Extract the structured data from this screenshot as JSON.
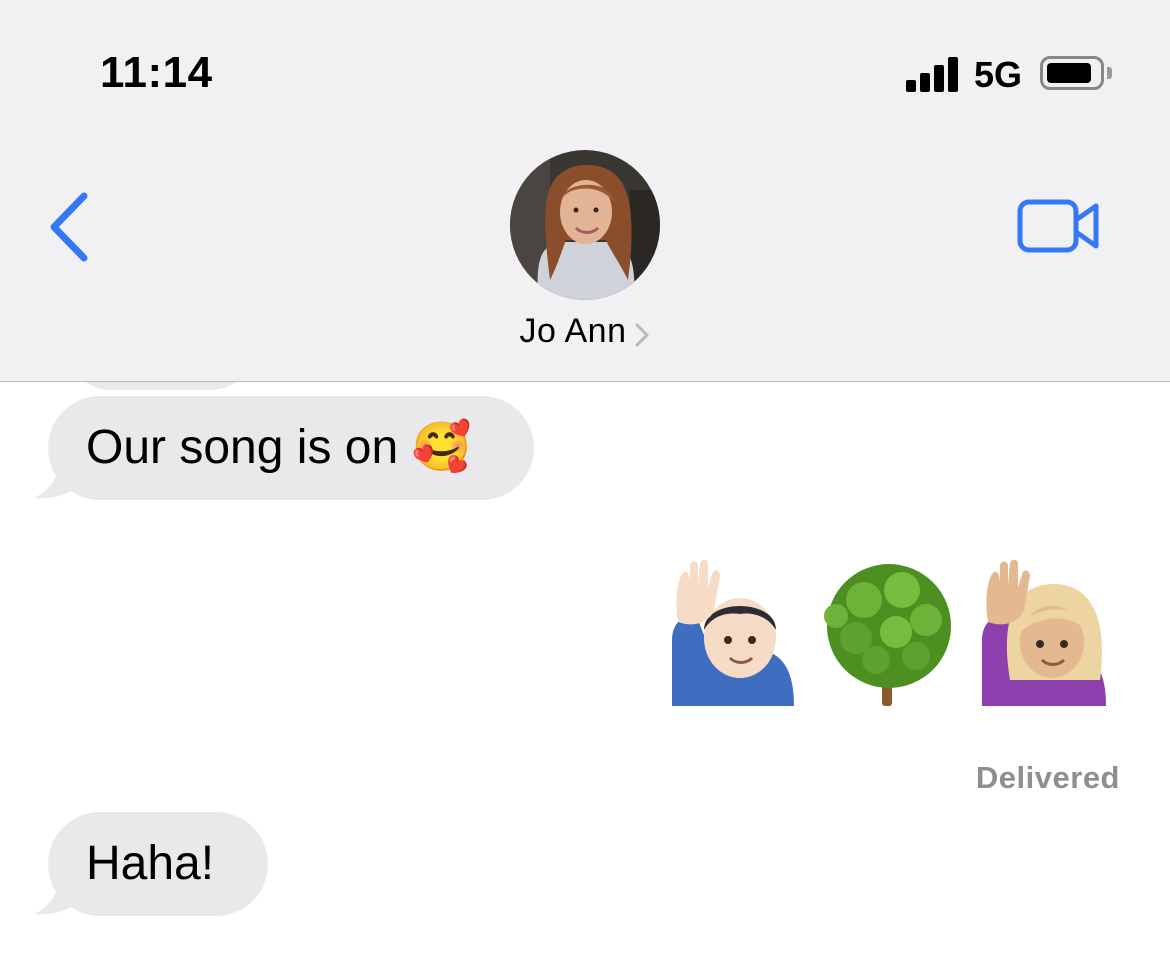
{
  "status_bar": {
    "time": "11:14",
    "network": "5G",
    "signal_bars": 4,
    "battery_level": 0.85
  },
  "nav": {
    "back_icon": "chevron-left-icon",
    "contact_name": "Jo Ann",
    "video_icon": "video-camera-icon",
    "accent_color": "#3478f6"
  },
  "messages": [
    {
      "direction": "incoming",
      "text": "Our song is on 🥰"
    },
    {
      "direction": "outgoing",
      "emojis": [
        "🙋🏻‍♂️",
        "🌳",
        "🙋🏼‍♀️"
      ]
    },
    {
      "direction": "incoming",
      "text": "Haha!"
    }
  ],
  "receipt": "Delivered",
  "colors": {
    "header_bg": "#f1f1f3",
    "incoming_bubble": "#e9e9eb",
    "receipt_text": "#8e8e93"
  }
}
